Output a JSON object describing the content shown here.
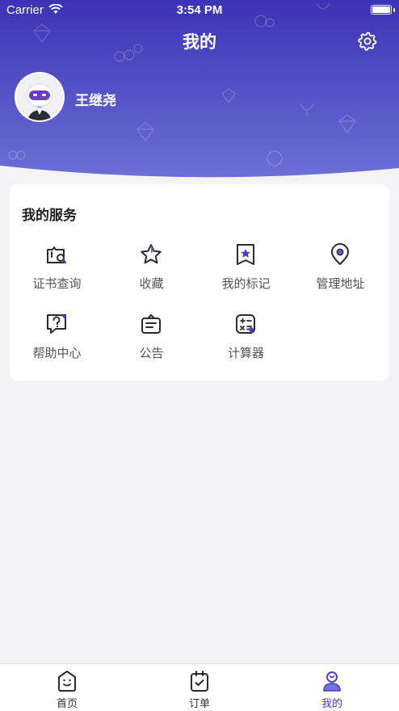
{
  "status_bar": {
    "carrier": "Carrier",
    "time": "3:54 PM"
  },
  "header": {
    "title": "我的",
    "user_name": "王继尧"
  },
  "services": {
    "title": "我的服务",
    "items": [
      {
        "label": "证书查询",
        "icon": "certificate-search-icon"
      },
      {
        "label": "收藏",
        "icon": "star-icon"
      },
      {
        "label": "我的标记",
        "icon": "bookmark-star-icon"
      },
      {
        "label": "管理地址",
        "icon": "location-pin-icon"
      },
      {
        "label": "帮助中心",
        "icon": "help-chat-icon"
      },
      {
        "label": "公告",
        "icon": "announcement-icon"
      },
      {
        "label": "计算器",
        "icon": "calculator-icon"
      }
    ]
  },
  "tabbar": {
    "tabs": [
      {
        "label": "首页",
        "icon": "home-face-icon"
      },
      {
        "label": "订单",
        "icon": "order-check-icon"
      },
      {
        "label": "我的",
        "icon": "profile-icon",
        "active": true
      }
    ]
  },
  "colors": {
    "accent": "#4b3fc5",
    "header_top": "#3c35b7",
    "header_bottom": "#6a6ad4"
  }
}
